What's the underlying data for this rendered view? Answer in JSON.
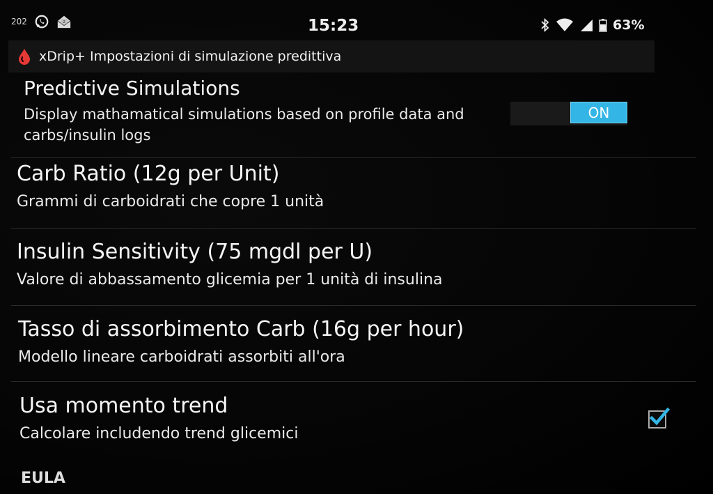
{
  "status_bar": {
    "notification_count": "202",
    "clock": "15:23",
    "battery": "63%",
    "icons": [
      "whatsapp-icon",
      "mail-icon",
      "bluetooth-icon",
      "wifi-icon",
      "signal-icon",
      "battery-icon"
    ]
  },
  "action_bar": {
    "title": "xDrip+ Impostazioni di simulazione predittiva",
    "icon": "blood-drop-icon",
    "accent_color": "#e53935"
  },
  "preferences": {
    "predictive": {
      "title": "Predictive Simulations",
      "summary": "Display mathamatical simulations based on profile data and carbs/insulin logs",
      "toggle_label": "ON",
      "toggle_color": "#33b5e5"
    },
    "carb_ratio": {
      "title": "Carb Ratio  (12g per Unit)",
      "summary": "Grammi di carboidrati che copre 1 unità"
    },
    "insulin_sensitivity": {
      "title": "Insulin Sensitivity  (75 mgdl per U)",
      "summary": "Valore di abbassamento glicemia per 1 unità di insulina"
    },
    "carb_absorption": {
      "title": "Tasso di assorbimento Carb  (16g per hour)",
      "summary": "Modello lineare carboidrati assorbiti all'ora"
    },
    "momentum": {
      "title": "Usa momento trend",
      "summary": "Calcolare includendo trend glicemici",
      "checked": true
    },
    "eula": {
      "label": "EULA"
    }
  }
}
